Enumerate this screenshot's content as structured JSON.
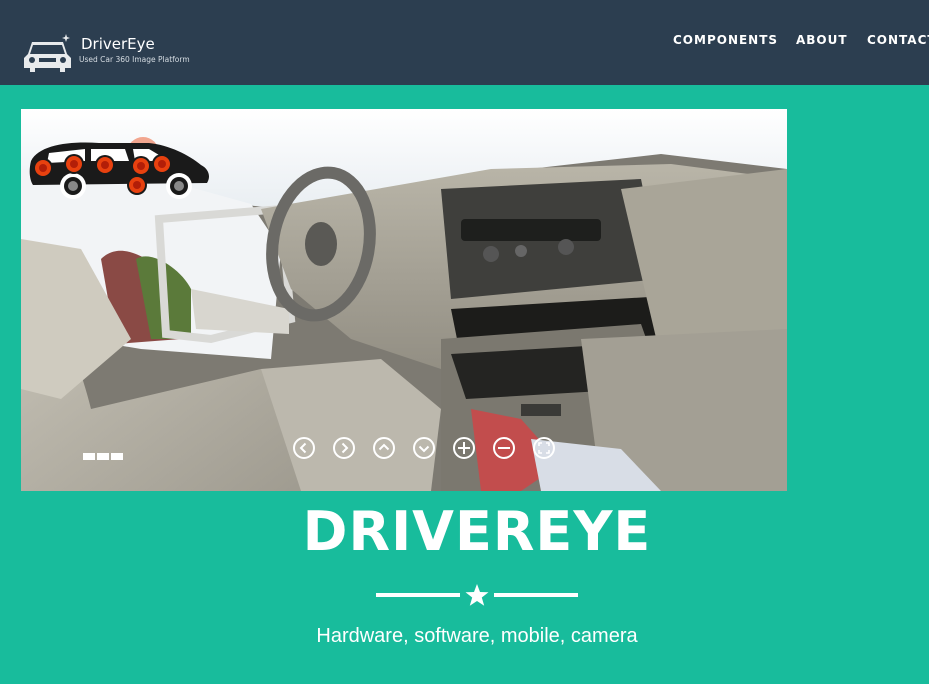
{
  "navbar": {
    "brand_name": "DriverEye",
    "brand_tagline": "Used Car 360 Image Platform",
    "links": [
      {
        "label": "COMPONENTS"
      },
      {
        "label": "ABOUT"
      },
      {
        "label": "CONTACT"
      }
    ]
  },
  "viewer": {
    "hotspot_count": 7,
    "controls": [
      "left-arrow",
      "right-arrow",
      "up-arrow",
      "down-arrow",
      "zoom-in",
      "zoom-out",
      "fullscreen"
    ]
  },
  "hero": {
    "title": "DRIVEREYE",
    "subtitle": "Hardware, software, mobile, camera"
  },
  "colors": {
    "navbar_bg": "#2c3e50",
    "page_bg": "#18bc9c",
    "hotspot": "#e8410f"
  }
}
